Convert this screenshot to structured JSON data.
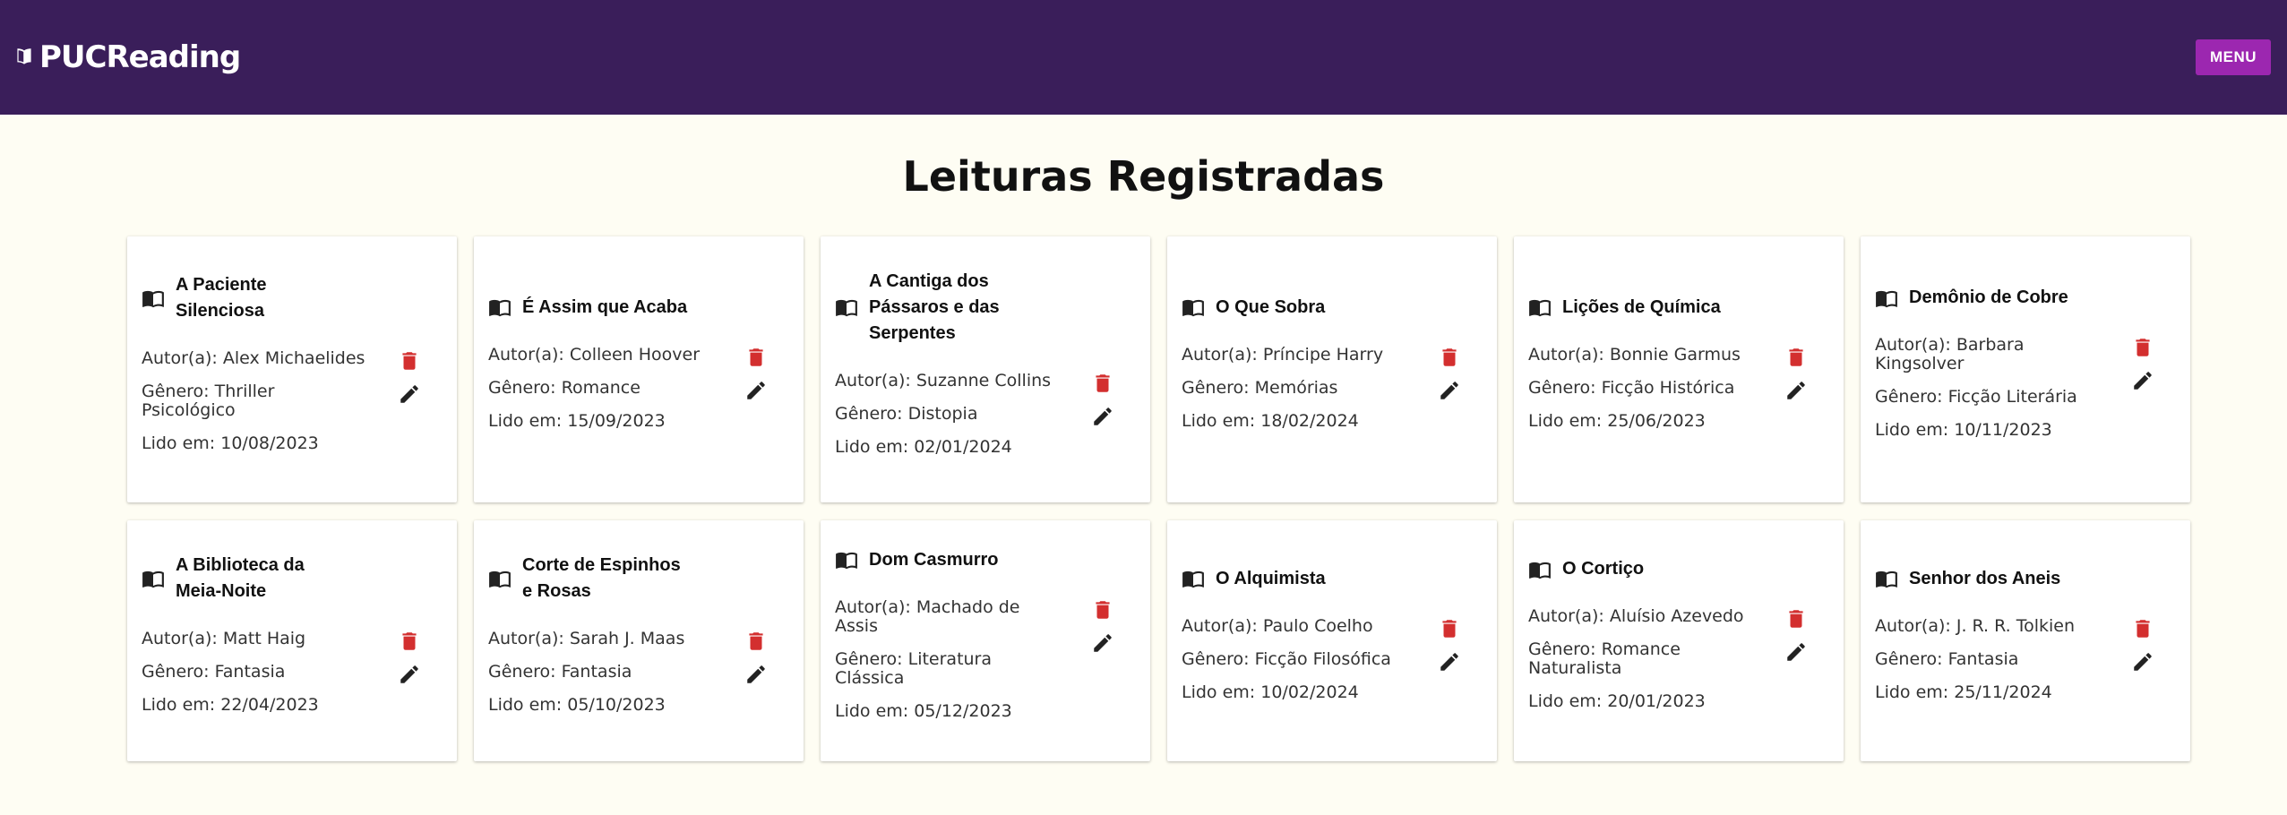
{
  "header": {
    "logo_text": "PUCReading",
    "menu_label": "MENU"
  },
  "page_title": "Leituras Registradas",
  "labels": {
    "author": "Autor(a): ",
    "genre": "Gênero: ",
    "read": "Lido em: "
  },
  "books": [
    {
      "title": "A Paciente Silenciosa",
      "author": "Alex Michaelides",
      "genre": "Thriller Psicológico",
      "date": "10/08/2023"
    },
    {
      "title": "É Assim que Acaba",
      "author": "Colleen Hoover",
      "genre": "Romance",
      "date": "15/09/2023"
    },
    {
      "title": "A Cantiga dos Pássaros e das Serpentes",
      "author": "Suzanne Collins",
      "genre": "Distopia",
      "date": "02/01/2024"
    },
    {
      "title": "O Que Sobra",
      "author": "Príncipe Harry",
      "genre": "Memórias",
      "date": "18/02/2024"
    },
    {
      "title": "Lições de Química",
      "author": "Bonnie Garmus",
      "genre": "Ficção Histórica",
      "date": "25/06/2023"
    },
    {
      "title": "Demônio de Cobre",
      "author": "Barbara Kingsolver",
      "genre": "Ficção Literária",
      "date": "10/11/2023"
    },
    {
      "title": "A Biblioteca da Meia-Noite",
      "author": "Matt Haig",
      "genre": "Fantasia",
      "date": "22/04/2023"
    },
    {
      "title": "Corte de Espinhos e Rosas",
      "author": "Sarah J. Maas",
      "genre": "Fantasia",
      "date": "05/10/2023"
    },
    {
      "title": "Dom Casmurro",
      "author": "Machado de Assis",
      "genre": "Literatura Clássica",
      "date": "05/12/2023"
    },
    {
      "title": "O Alquimista",
      "author": "Paulo Coelho",
      "genre": "Ficção Filosófica",
      "date": "10/02/2024"
    },
    {
      "title": "O Cortiço",
      "author": "Aluísio Azevedo",
      "genre": "Romance Naturalista",
      "date": "20/01/2023"
    },
    {
      "title": "Senhor dos Aneis",
      "author": "J. R. R. Tolkien",
      "genre": "Fantasia",
      "date": "25/11/2024"
    }
  ],
  "icons": {
    "book": "menu-book-icon",
    "delete": "trash-icon",
    "edit": "pencil-icon"
  },
  "colors": {
    "header_bg": "#3a1e5a",
    "menu_button": "#9c27b0",
    "delete": "#d32f2f",
    "background": "#fefdf3"
  }
}
